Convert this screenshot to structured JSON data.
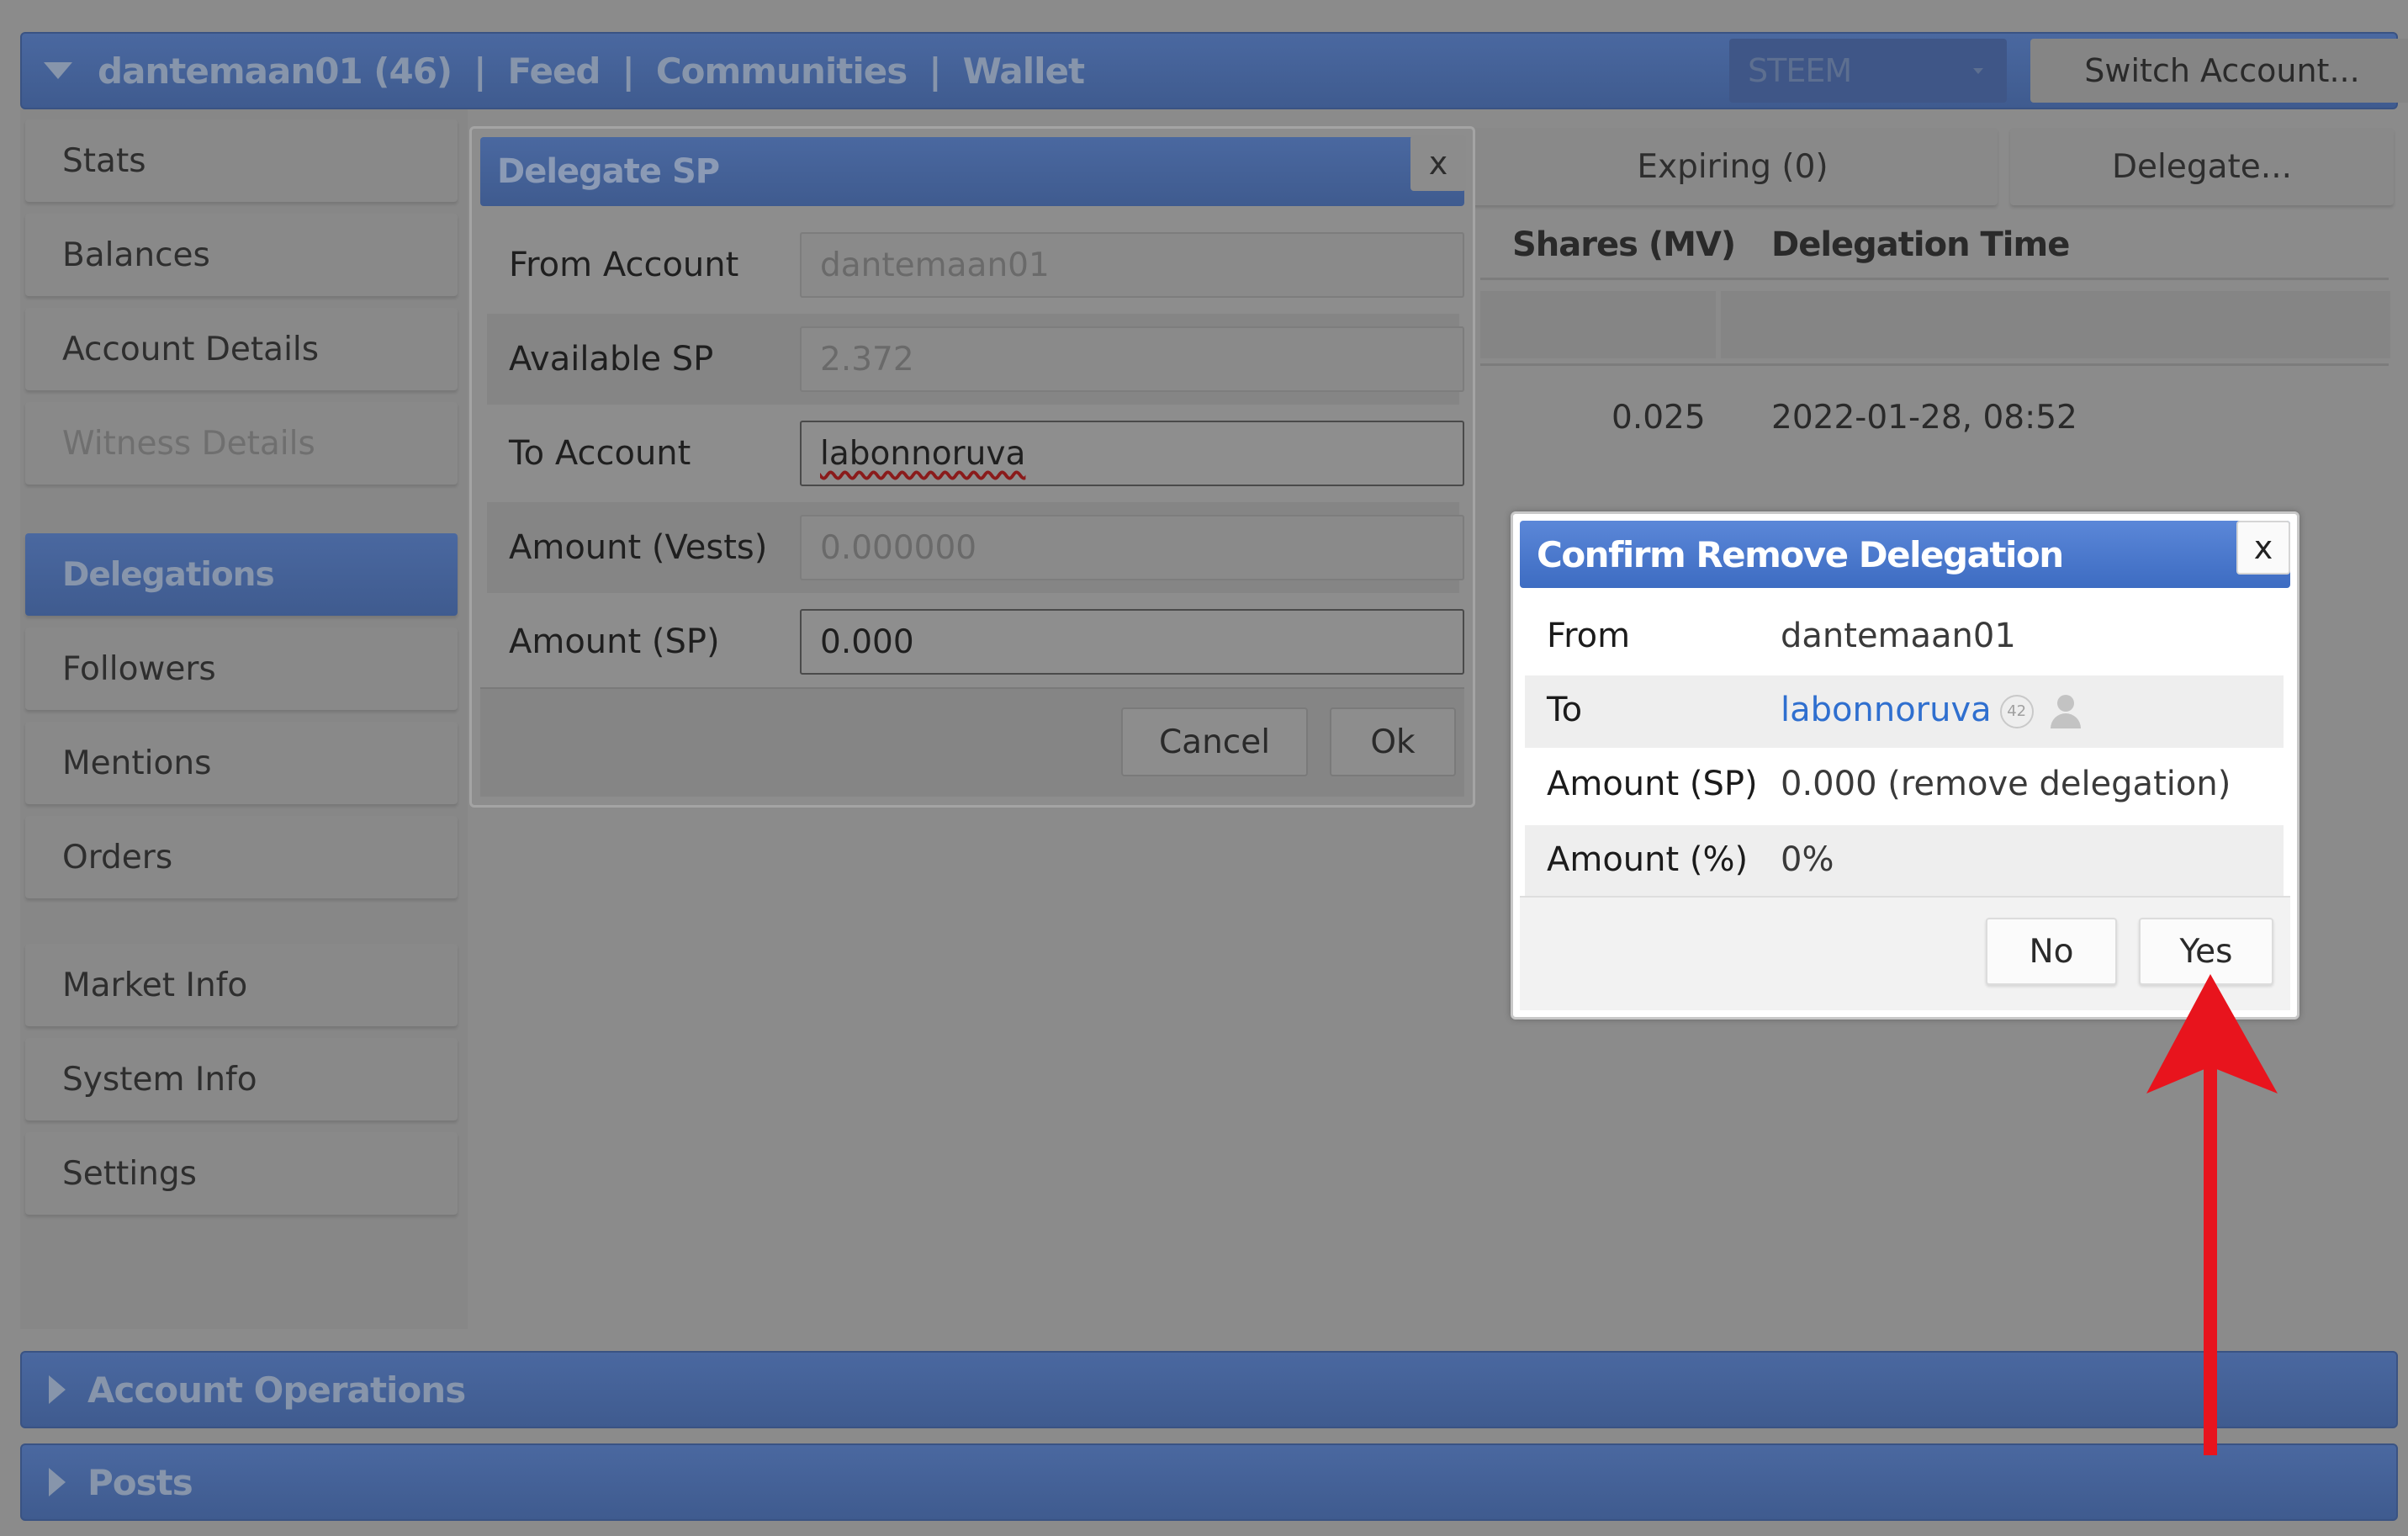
{
  "header": {
    "account": "dantemaan01 (46)",
    "separator": "|",
    "nav": [
      "Feed",
      "Communities",
      "Wallet"
    ],
    "chain_select": "STEEM",
    "switch_account": "Switch Account..."
  },
  "sidebar": {
    "items": [
      {
        "label": "Stats",
        "state": "normal"
      },
      {
        "label": "Balances",
        "state": "normal"
      },
      {
        "label": "Account Details",
        "state": "normal"
      },
      {
        "label": "Witness Details",
        "state": "disabled"
      },
      {
        "label": "Delegations",
        "state": "active"
      },
      {
        "label": "Followers",
        "state": "normal"
      },
      {
        "label": "Mentions",
        "state": "normal"
      },
      {
        "label": "Orders",
        "state": "normal"
      },
      {
        "label": "Market Info",
        "state": "normal"
      },
      {
        "label": "System Info",
        "state": "normal"
      },
      {
        "label": "Settings",
        "state": "normal"
      }
    ]
  },
  "main": {
    "tabs": [
      "Expiring (0)",
      "Delegate..."
    ],
    "columns": [
      "Shares (MV)",
      "Delegation Time"
    ],
    "rows": [
      {
        "shares": "0.025",
        "time": "2022-01-28, 08:52"
      }
    ]
  },
  "bottom_panels": [
    "Account Operations",
    "Posts"
  ],
  "delegate_dialog": {
    "title": "Delegate SP",
    "close": "x",
    "fields": [
      {
        "label": "From Account",
        "value": "dantemaan01",
        "enabled": false
      },
      {
        "label": "Available SP",
        "value": "2.372",
        "enabled": false
      },
      {
        "label": "To Account",
        "value": "labonnoruva",
        "enabled": true
      },
      {
        "label": "Amount (Vests)",
        "value": "0.000000",
        "enabled": false
      },
      {
        "label": "Amount (SP)",
        "value": "0.000",
        "enabled": true
      }
    ],
    "cancel": "Cancel",
    "ok": "Ok"
  },
  "confirm_dialog": {
    "title": "Confirm Remove Delegation",
    "close": "x",
    "from_label": "From",
    "from_value": "dantemaan01",
    "to_label": "To",
    "to_value": "labonnoruva",
    "to_reputation": "42",
    "amount_sp_label": "Amount (SP)",
    "amount_sp_value": "0.000 (remove delegation)",
    "amount_pct_label": "Amount (%)",
    "amount_pct_value": "0%",
    "no": "No",
    "yes": "Yes"
  },
  "annotation": {
    "arrow_color": "#e8141d",
    "points_to": "yes-button"
  },
  "colors": {
    "accent_blue": "#3d6cc2",
    "link": "#2f6fcf",
    "overlay_gray": "#8b8b8b"
  }
}
